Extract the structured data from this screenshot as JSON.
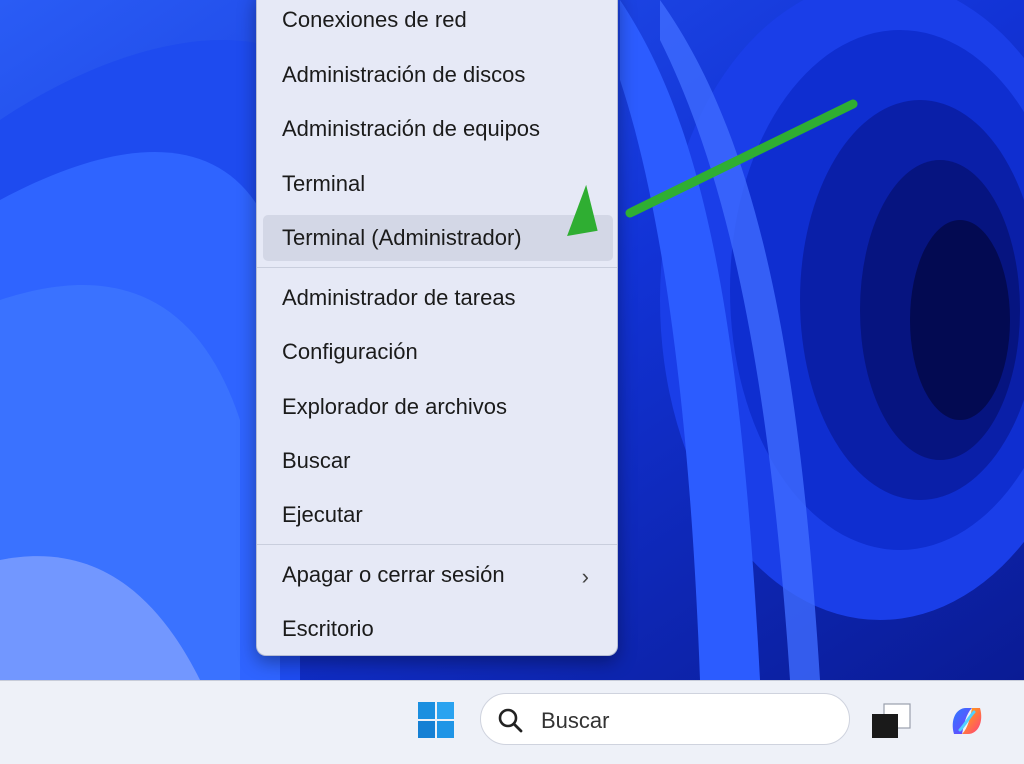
{
  "context_menu": {
    "items": [
      {
        "label": "Conexiones de red"
      },
      {
        "label": "Administración de discos"
      },
      {
        "label": "Administración de equipos"
      },
      {
        "label": "Terminal"
      },
      {
        "label": "Terminal (Administrador)"
      },
      {
        "label": "Administrador de tareas"
      },
      {
        "label": "Configuración"
      },
      {
        "label": "Explorador de archivos"
      },
      {
        "label": "Buscar"
      },
      {
        "label": "Ejecutar"
      },
      {
        "label": "Apagar o cerrar sesión"
      },
      {
        "label": "Escritorio"
      }
    ],
    "highlighted_item": "Terminal (Administrador)",
    "submenu_indicator": "›"
  },
  "annotation": {
    "arrow_color": "#2fae32",
    "points_to": "Terminal (Administrador)"
  },
  "taskbar": {
    "search_placeholder": "Buscar",
    "icons": [
      "windows-start-icon",
      "search-icon",
      "task-view-icon",
      "copilot-icon"
    ]
  },
  "colors": {
    "wallpaper": "#1d3fe0",
    "menu_bg": "#e6e9f6",
    "highlight": "#d3d7e6",
    "taskbar_bg": "#eef1f8"
  }
}
